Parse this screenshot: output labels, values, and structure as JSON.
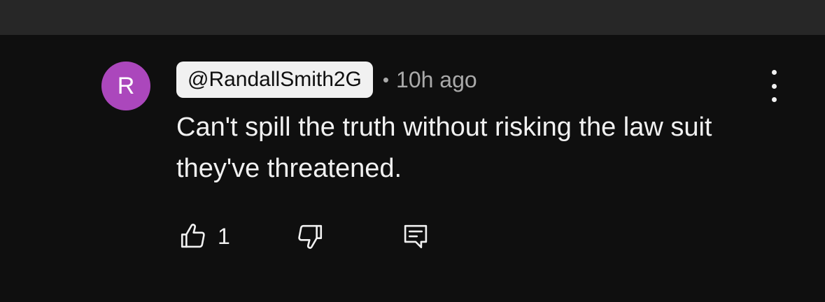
{
  "comment": {
    "avatar_letter": "R",
    "avatar_color": "#ab47bc",
    "author": "@RandallSmith2G",
    "separator": "•",
    "time": "10h ago",
    "text": "Can't spill the truth without risking the law suit they've threatened.",
    "like_count": "1"
  },
  "icons": {
    "menu": "more-vertical-icon",
    "like": "thumbs-up-icon",
    "dislike": "thumbs-down-icon",
    "reply": "reply-comment-icon"
  }
}
